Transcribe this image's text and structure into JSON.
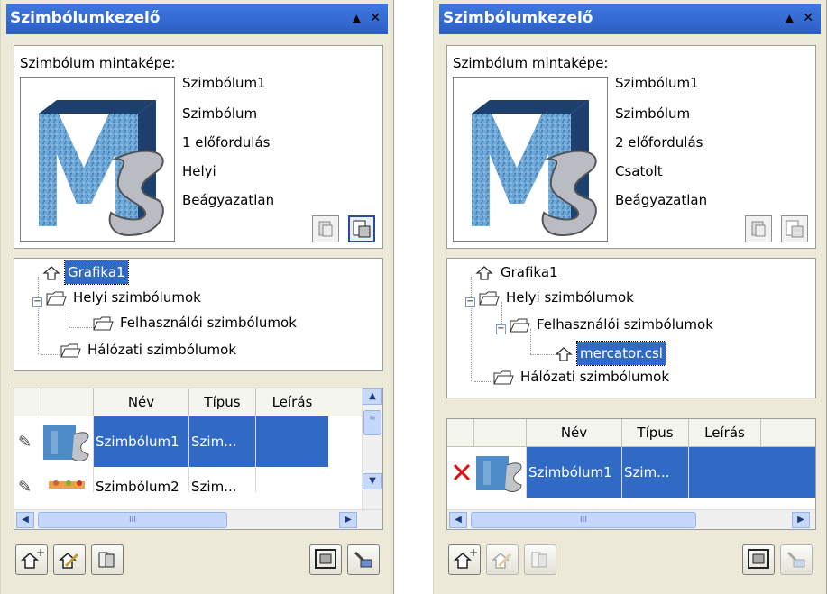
{
  "panels": [
    {
      "title": "Szimbólumkezelő",
      "preview_label": "Szimbólum mintaképe:",
      "info": [
        "Szimbólum1",
        "Szimbólum",
        "1 előfordulás",
        "Helyi",
        "Beágyazatlan"
      ],
      "tree": {
        "grafika": "Grafika1",
        "local": "Helyi szimbólumok",
        "user": "Felhasználói szimbólumok",
        "network": "Hálózati szimbólumok"
      },
      "list": {
        "col_name": "Név",
        "col_type": "Típus",
        "col_desc": "Leírás",
        "rows": [
          {
            "name": "Szimbólum1",
            "type": "Szim..."
          },
          {
            "name": "Szimbólum2",
            "type": "Szim..."
          }
        ],
        "scroll_grip": "III"
      }
    },
    {
      "title": "Szimbólumkezelő",
      "preview_label": "Szimbólum mintaképe:",
      "info": [
        "Szimbólum1",
        "Szimbólum",
        "2 előfordulás",
        "Csatolt",
        "Beágyazatlan"
      ],
      "tree": {
        "grafika": "Grafika1",
        "local": "Helyi szimbólumok",
        "user": "Felhasználói szimbólumok",
        "file": "mercator.csl",
        "network": "Hálózati szimbólumok"
      },
      "list": {
        "col_name": "Név",
        "col_type": "Típus",
        "col_desc": "Leírás",
        "rows": [
          {
            "name": "Szimbólum1",
            "type": "Szim..."
          }
        ],
        "scroll_grip": "III"
      }
    }
  ],
  "icons": {
    "titlebar_up": "triangle-up-icon",
    "titlebar_close": "close-icon",
    "folder": "folder-icon",
    "symbol": "symbol-icon",
    "toolbar": [
      "new-symbol-icon",
      "edit-symbol-icon",
      "export-icon",
      "zoom-fit-icon",
      "delete-icon"
    ]
  }
}
